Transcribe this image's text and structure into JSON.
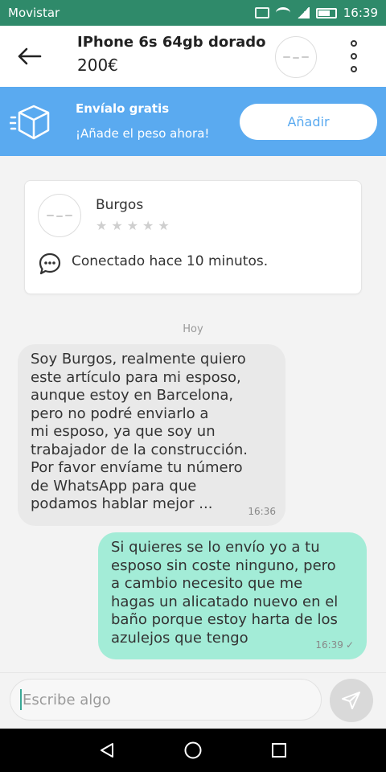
{
  "status_bar": {
    "carrier": "Movistar",
    "time": "16:39"
  },
  "header": {
    "title": "IPhone 6s 64gb dorado",
    "price": "200€"
  },
  "banner": {
    "title": "Envíalo gratis",
    "subtitle": "¡Añade el peso ahora!",
    "button": "Añadir",
    "color": "#5aaaf0"
  },
  "profile": {
    "name": "Burgos",
    "rating_stars": 0,
    "status": "Conectado hace 10 minutos."
  },
  "chat": {
    "day_label": "Hoy",
    "messages": [
      {
        "direction": "in",
        "text": "Soy Burgos, realmente quiero\neste artículo para mi esposo,\naunque estoy en Barcelona,\npero no podré enviarlo a\nmi esposo, ya que soy un\ntrabajador de la construcción.\nPor favor envíame tu número\nde WhatsApp para que\npodamos hablar mejor ...",
        "time": "16:36"
      },
      {
        "direction": "out",
        "text": "Si quieres se lo envío yo a tu\nesposo sin coste ninguno, pero\na cambio necesito que me\nhagas un alicatado nuevo en el\nbaño porque estoy harta de los\nazulejos que tengo",
        "time": "16:39",
        "status_icon": "check-icon"
      }
    ]
  },
  "composer": {
    "placeholder": "Escribe algo"
  },
  "colors": {
    "status_bar": "#2f8a6a",
    "outgoing_bubble": "#a3ecd7",
    "incoming_bubble": "#e9e9e9"
  }
}
